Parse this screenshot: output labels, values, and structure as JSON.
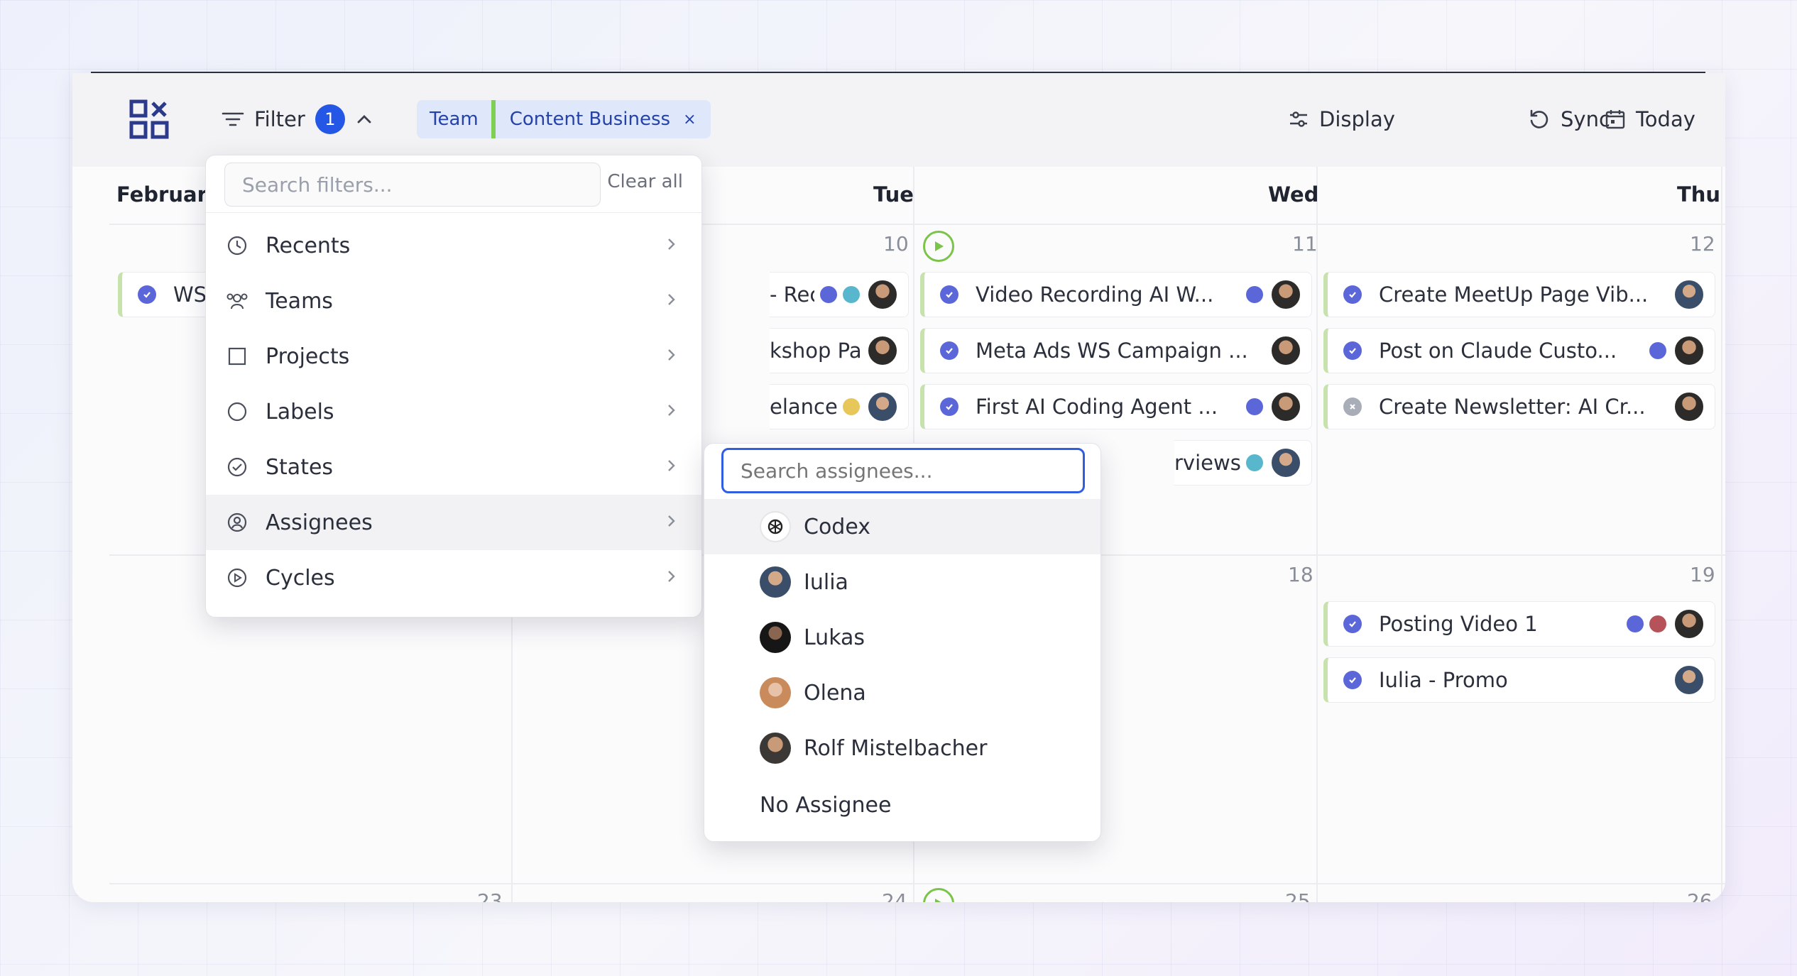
{
  "toolbar": {
    "filter_label": "Filter",
    "filter_count": "1",
    "chip_team": "Team",
    "chip_value": "Content Business",
    "chip_remove": "×",
    "display_label": "Display",
    "sync_label": "Sync",
    "today_label": "Today"
  },
  "calendar": {
    "headers": [
      "February",
      "Tue",
      "Wed",
      "Thu"
    ],
    "day_numbers": [
      "10",
      "11",
      "12",
      "18",
      "19",
      "23",
      "24",
      "25",
      "26"
    ],
    "cards": [
      {
        "title": "WS",
        "state": "done"
      },
      {
        "title": "- Recre...",
        "state": "done"
      },
      {
        "title": "kshop Page",
        "state": "done"
      },
      {
        "title": "elance (Ye...",
        "state": "done"
      },
      {
        "title": "Video Recording AI W...",
        "state": "done"
      },
      {
        "title": "Meta Ads WS Campaign ...",
        "state": "done"
      },
      {
        "title": "First AI Coding Agent ...",
        "state": "done"
      },
      {
        "title": "rviews Im...",
        "state": "done"
      },
      {
        "title": "Create MeetUp Page Vib...",
        "state": "done"
      },
      {
        "title": "Post on Claude Custo...",
        "state": "done"
      },
      {
        "title": "Create Newsletter: AI Cr...",
        "state": "canceled"
      },
      {
        "title": "Posting Video 1",
        "state": "done"
      },
      {
        "title": "Iulia - Promo",
        "state": "done"
      }
    ],
    "colors": {
      "check": "#5b67d9",
      "purple": "#5b67d9",
      "teal": "#58b7cc",
      "yellow": "#e8c75a",
      "red": "#b5525a",
      "accent_green": "#7bc44a"
    }
  },
  "filter_menu": {
    "search_placeholder": "Search filters...",
    "clear_all": "Clear all",
    "items": [
      {
        "label": "Recents",
        "icon": "clock-icon"
      },
      {
        "label": "Teams",
        "icon": "teams-icon"
      },
      {
        "label": "Projects",
        "icon": "square-icon"
      },
      {
        "label": "Labels",
        "icon": "circle-icon"
      },
      {
        "label": "States",
        "icon": "check-circle-icon"
      },
      {
        "label": "Assignees",
        "icon": "user-circle-icon"
      },
      {
        "label": "Cycles",
        "icon": "play-circle-icon"
      }
    ],
    "active": "Assignees"
  },
  "assignee_menu": {
    "search_placeholder": "Search assignees...",
    "items": [
      {
        "label": "Codex"
      },
      {
        "label": "Iulia"
      },
      {
        "label": "Lukas"
      },
      {
        "label": "Olena"
      },
      {
        "label": "Rolf Mistelbacher"
      },
      {
        "label": "No Assignee"
      }
    ]
  }
}
